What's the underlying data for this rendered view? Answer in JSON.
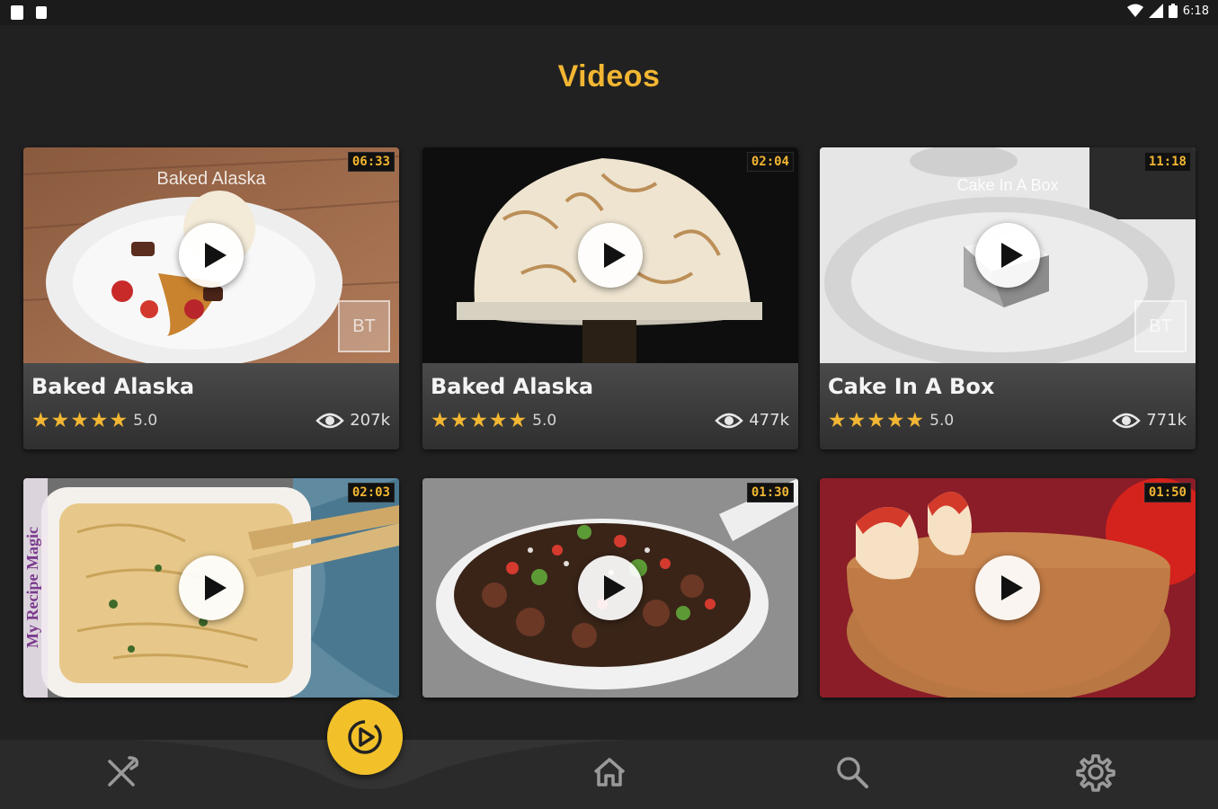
{
  "status_bar": {
    "time": "6:18"
  },
  "page_title": "Videos",
  "colors": {
    "accent": "#f2b632",
    "background": "#212121",
    "card": "#3b3b3b"
  },
  "videos": [
    {
      "title": "Baked Alaska",
      "duration": "06:33",
      "rating": "5.0",
      "views": "207k",
      "overlay": "Baked Alaska",
      "watermark": "BT"
    },
    {
      "title": "Baked Alaska",
      "duration": "02:04",
      "rating": "5.0",
      "views": "477k"
    },
    {
      "title": "Cake In A Box",
      "duration": "11:18",
      "rating": "5.0",
      "views": "771k",
      "overlay": "Cake In A Box",
      "watermark": "BT"
    },
    {
      "duration": "02:03",
      "side_text": "My Recipe Magic"
    },
    {
      "duration": "01:30"
    },
    {
      "duration": "01:50"
    }
  ],
  "nav": {
    "items": [
      {
        "icon": "fork-knife-icon"
      },
      {
        "icon": "play-circle-icon",
        "active": true
      },
      {
        "icon": "home-icon"
      },
      {
        "icon": "search-icon"
      },
      {
        "icon": "gear-icon"
      }
    ]
  }
}
